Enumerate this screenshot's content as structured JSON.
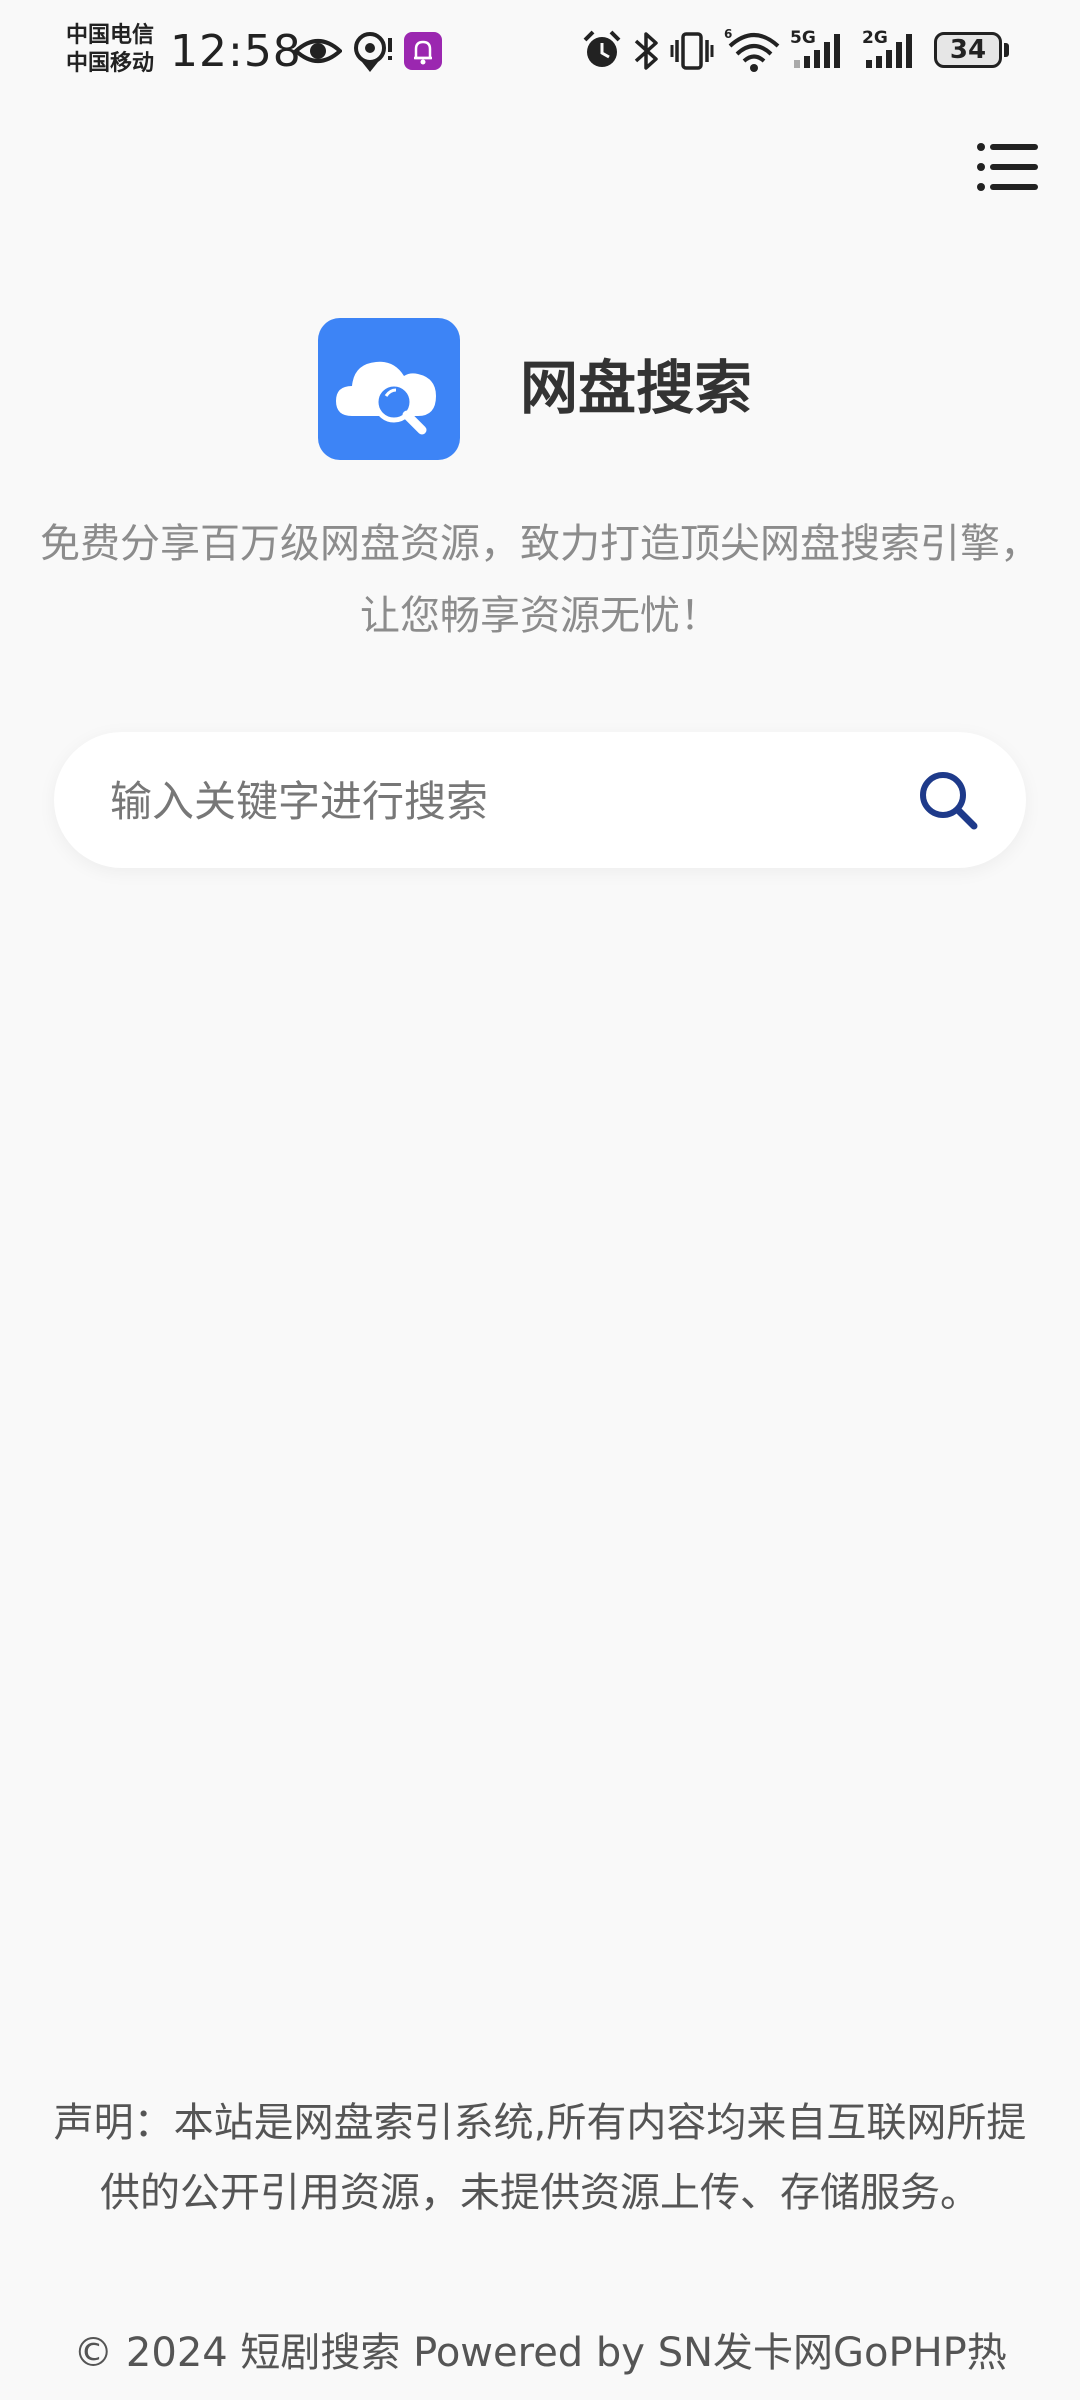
{
  "status_bar": {
    "carrier_1": "中国电信",
    "carrier_2": "中国移动",
    "time": "12:58",
    "net_1": "5G",
    "net_2": "2G",
    "battery": "34"
  },
  "header": {
    "title": "网盘搜索",
    "logo_icon": "cloud-search-icon",
    "tagline": "免费分享百万级网盘资源，致力打造顶尖网盘搜索引擎，让您畅享资源无忧！",
    "menu_icon": "hamburger-menu-icon"
  },
  "search": {
    "placeholder": "输入关键字进行搜索",
    "value": "",
    "icon": "search-icon"
  },
  "footer": {
    "disclaimer": "声明：本站是网盘索引系统,所有内容均来自互联网所提供的公开引用资源，未提供资源上传、存储服务。",
    "copyright": "© 2024 短剧搜索 Powered by SN发卡网GoPHP热"
  },
  "colors": {
    "accent": "#3d84f6",
    "search_icon": "#1e3a8a",
    "background": "#f9f9f9"
  }
}
